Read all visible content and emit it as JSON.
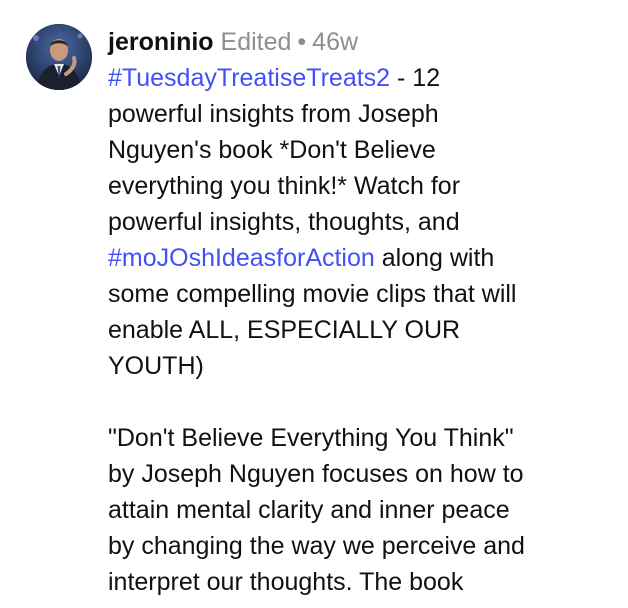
{
  "post": {
    "username": "jeroninio",
    "edited_label": "Edited",
    "separator": "•",
    "age": "46w",
    "caption": {
      "hashtag1": "#TuesdayTreatiseTreats2",
      "line1_rest": " - 12",
      "line2": "powerful insights from Joseph",
      "line3": "Nguyen's book *Don't Believe",
      "line4": "everything you think!* Watch for",
      "line5": "powerful insights, thoughts, and",
      "hashtag2": "#moJOshIdeasforAction",
      "line6_rest": " along with",
      "line7": "some compelling movie clips that will",
      "line8": "enable ALL, ESPECIALLY OUR",
      "line9": "YOUTH)",
      "p2_line1": "\"Don't Believe Everything You Think\"",
      "p2_line2": "by Joseph Nguyen focuses on how to",
      "p2_line3": "attain mental clarity and inner peace",
      "p2_line4": "by changing the way we perceive and",
      "p2_line5": "interpret our thoughts. The book"
    }
  },
  "colors": {
    "hashtag": "#4150f7",
    "meta": "#8e8e8e",
    "text": "#111111"
  }
}
